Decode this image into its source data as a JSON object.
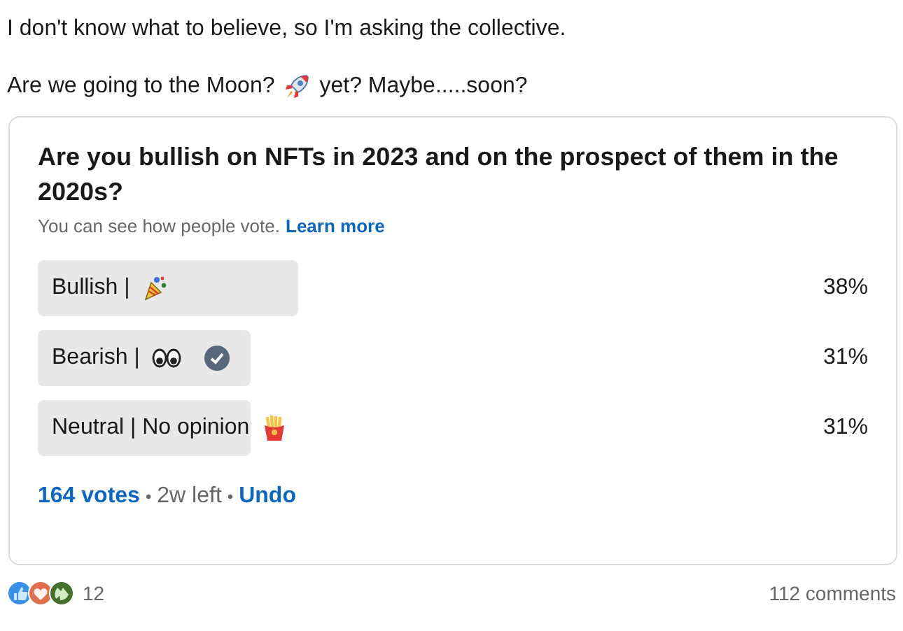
{
  "post": {
    "line_1": "I don't know what to believe, so I'm asking the collective.",
    "line_2_before": "Are we going to the Moon?",
    "line_2_after": "yet? Maybe.....soon?"
  },
  "poll": {
    "question": "Are you bullish on NFTs in 2023 and on the prospect of them in the 2020s?",
    "visibility_note": "You can see how people vote.",
    "learn_more": "Learn more",
    "options": [
      {
        "label": "Bullish |",
        "percent": "38%",
        "selected": false
      },
      {
        "label": "Bearish |",
        "percent": "31%",
        "selected": true
      },
      {
        "label": "Neutral | No opinion",
        "percent": "31%",
        "selected": false
      }
    ],
    "votes": "164 votes",
    "separator_1": "•",
    "time_left": "2w left",
    "separator_2": "•",
    "undo": "Undo"
  },
  "social": {
    "reaction_count": "12",
    "comments": "112 comments"
  }
}
